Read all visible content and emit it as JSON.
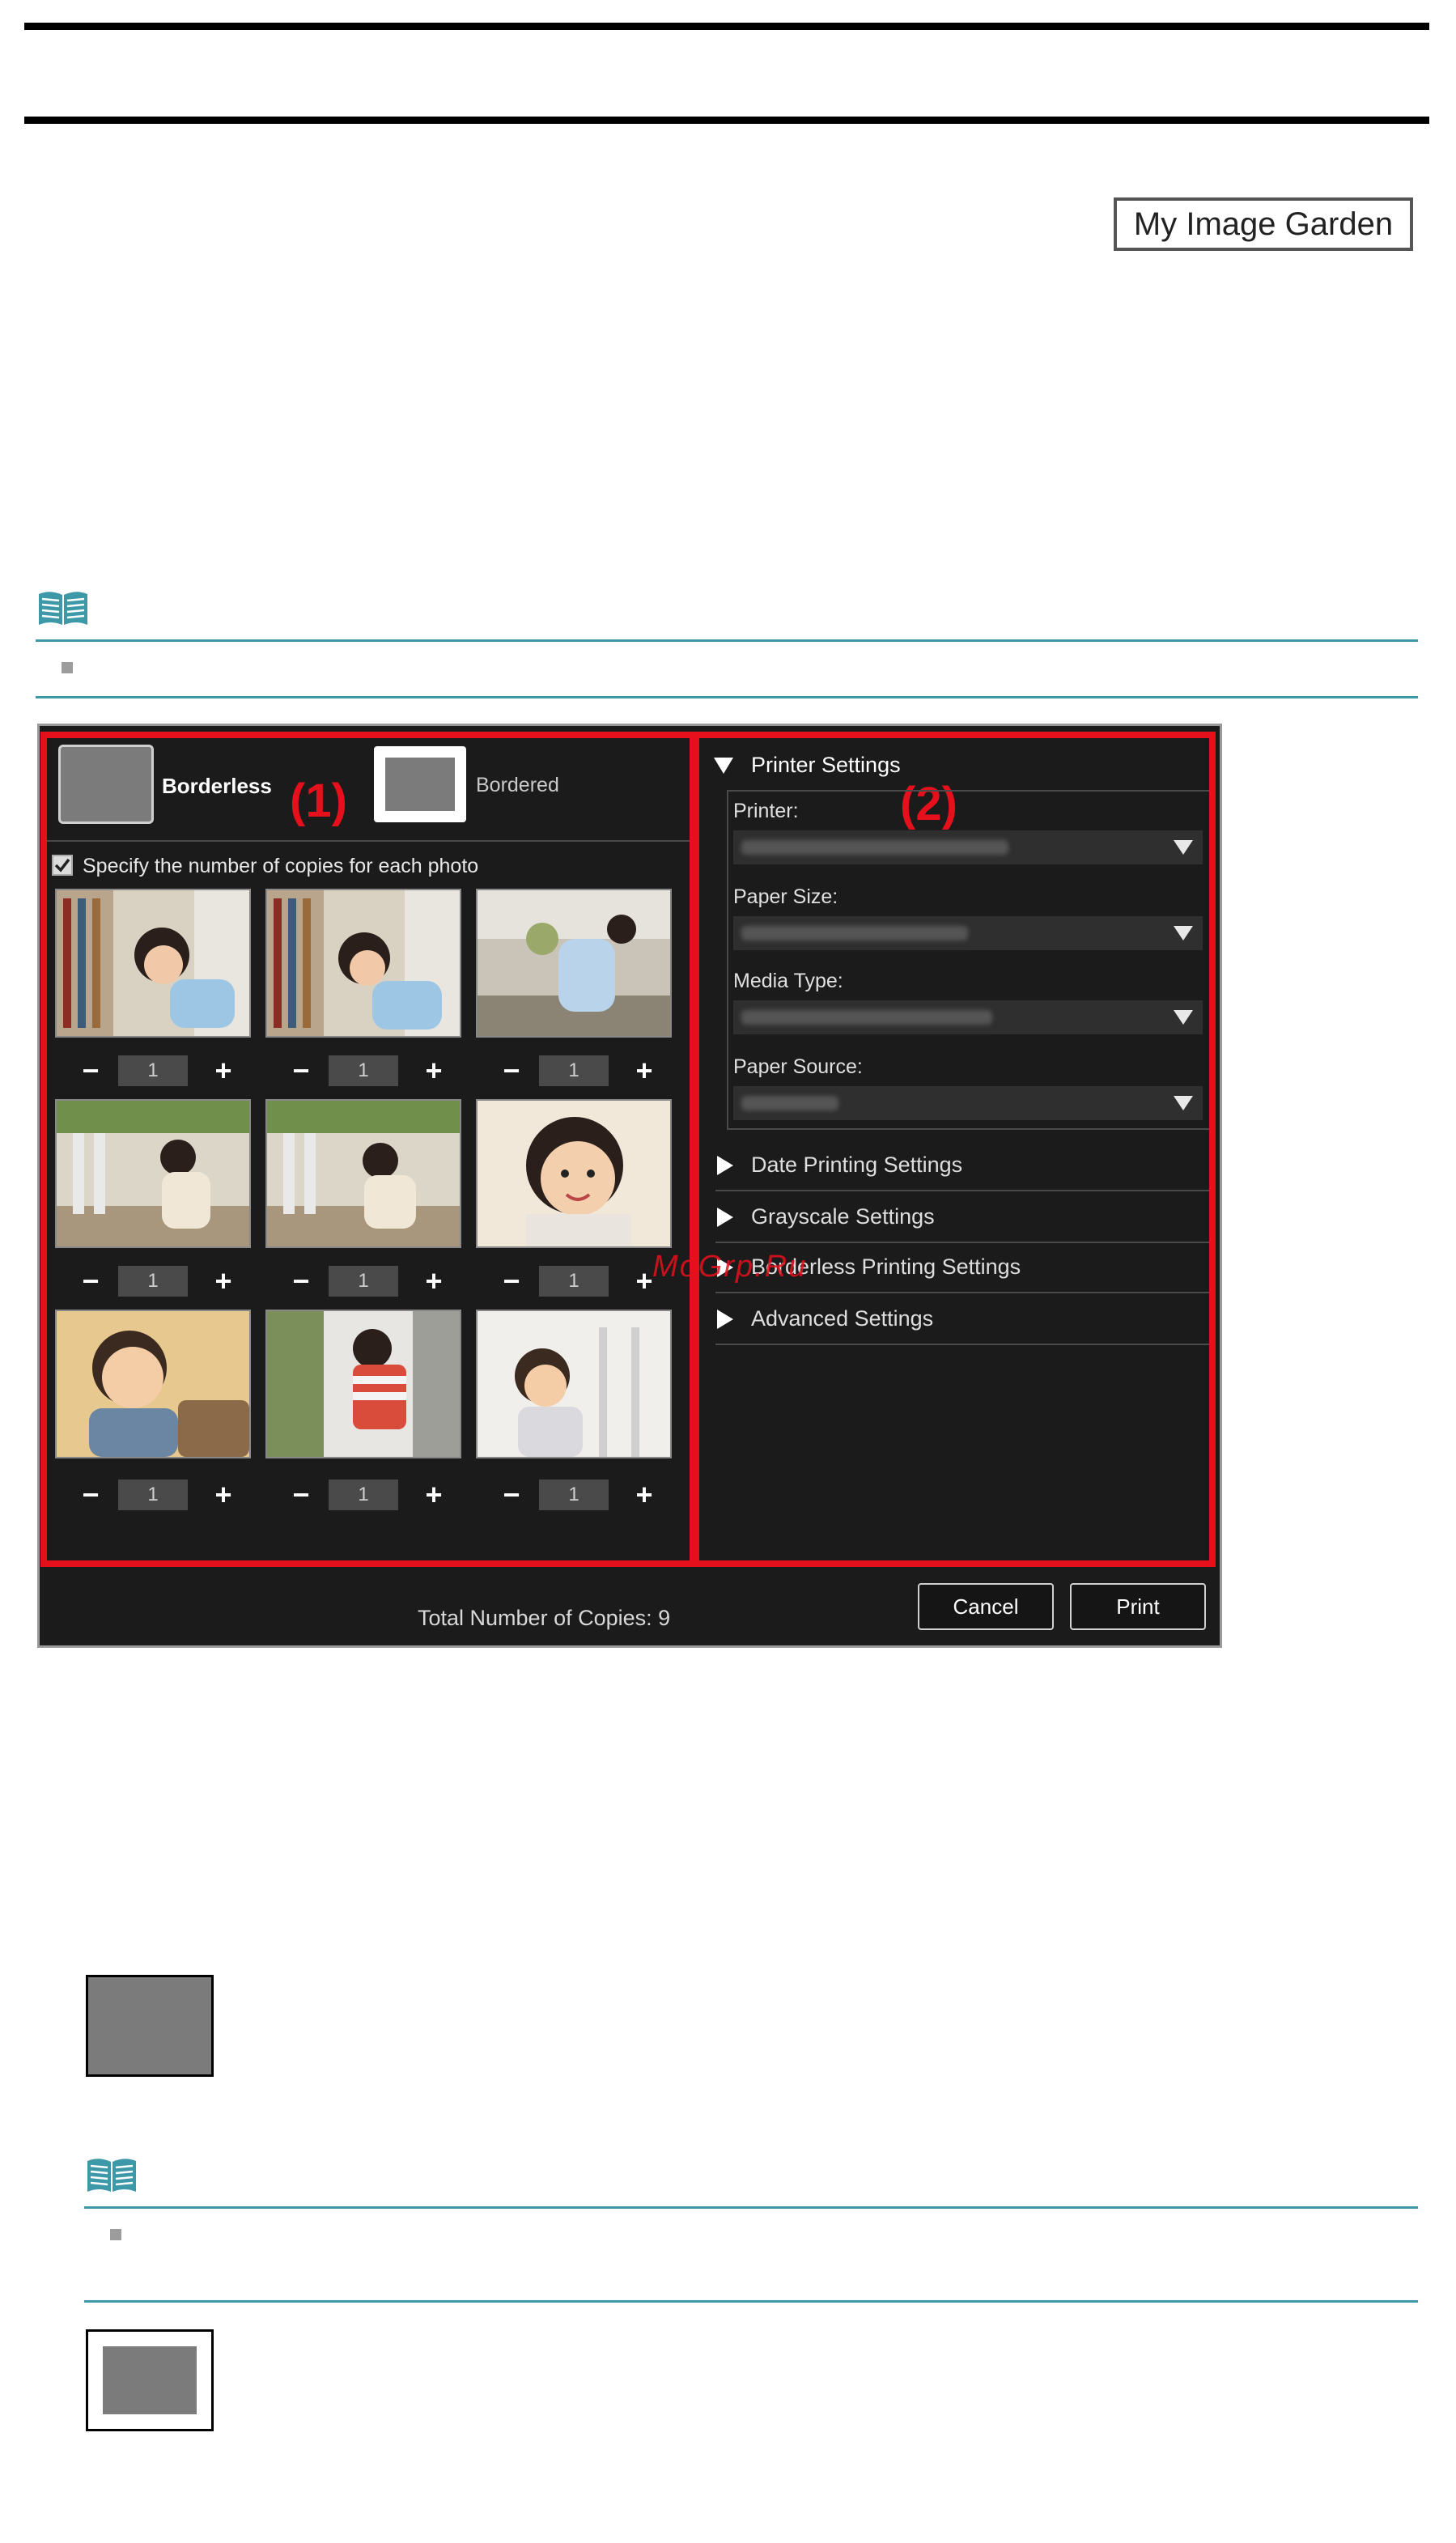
{
  "header": {
    "badge_label": "My Image Garden"
  },
  "dialog": {
    "layout_options": [
      {
        "label": "Borderless",
        "selected": true
      },
      {
        "label": "Bordered",
        "selected": false
      }
    ],
    "region_labels": [
      "(1)",
      "(2)"
    ],
    "specify_copies": {
      "label": "Specify the number of copies for each photo",
      "checked": true
    },
    "photos": [
      {
        "copies": "1",
        "minus": "−",
        "plus": "+"
      },
      {
        "copies": "1",
        "minus": "−",
        "plus": "+"
      },
      {
        "copies": "1",
        "minus": "−",
        "plus": "+"
      },
      {
        "copies": "1",
        "minus": "−",
        "plus": "+"
      },
      {
        "copies": "1",
        "minus": "−",
        "plus": "+"
      },
      {
        "copies": "1",
        "minus": "−",
        "plus": "+"
      },
      {
        "copies": "1",
        "minus": "−",
        "plus": "+"
      },
      {
        "copies": "1",
        "minus": "−",
        "plus": "+"
      },
      {
        "copies": "1",
        "minus": "−",
        "plus": "+"
      }
    ],
    "printer_settings": {
      "title": "Printer Settings",
      "fields": [
        {
          "label": "Printer:"
        },
        {
          "label": "Paper Size:"
        },
        {
          "label": "Media Type:"
        },
        {
          "label": "Paper Source:"
        }
      ]
    },
    "sections": [
      "Date Printing Settings",
      "Grayscale Settings",
      "Borderless Printing Settings",
      "Advanced Settings"
    ],
    "footer": {
      "total_copies": "Total Number of Copies:  9",
      "cancel_label": "Cancel",
      "print_label": "Print"
    }
  },
  "watermark": "MoGrp.Ru",
  "colors": {
    "highlight": "#e5101b",
    "note_teal": "#3d99a8",
    "dialog_bg": "#1b1b1b"
  }
}
